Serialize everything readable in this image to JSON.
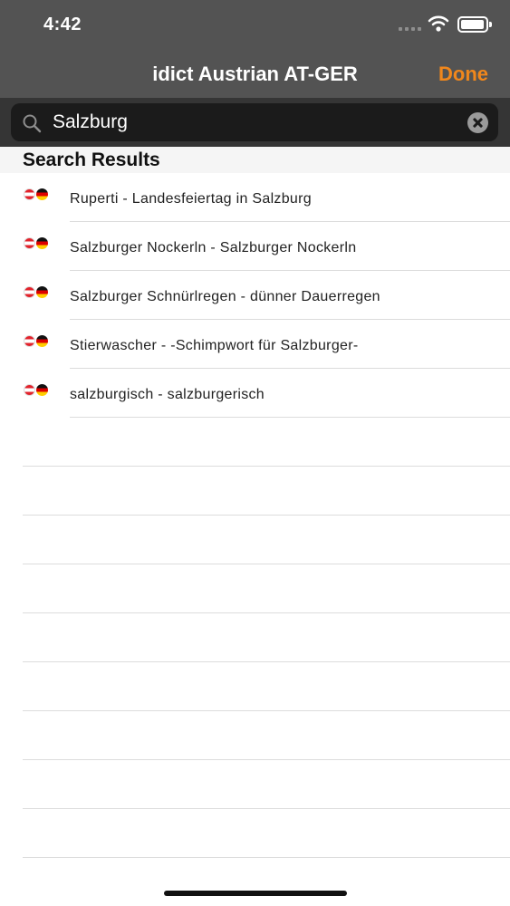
{
  "status_bar": {
    "time": "4:42"
  },
  "nav": {
    "title": "idict Austrian AT-GER",
    "done_label": "Done"
  },
  "search": {
    "value": "Salzburg"
  },
  "section": {
    "title": "Search Results"
  },
  "results": [
    {
      "text": "Ruperti - Landesfeiertag in Salzburg",
      "flags": [
        "austria-flag-icon",
        "germany-flag-icon"
      ]
    },
    {
      "text": "Salzburger Nockerln - Salzburger Nockerln",
      "flags": [
        "austria-flag-icon",
        "germany-flag-icon"
      ]
    },
    {
      "text": "Salzburger Schnürlregen - dünner Dauerregen",
      "flags": [
        "austria-flag-icon",
        "germany-flag-icon"
      ]
    },
    {
      "text": "Stierwascher - -Schimpwort für Salzburger-",
      "flags": [
        "austria-flag-icon",
        "germany-flag-icon"
      ]
    },
    {
      "text": "salzburgisch - salzburgerisch",
      "flags": [
        "austria-flag-icon",
        "germany-flag-icon"
      ]
    }
  ],
  "colors": {
    "bar_background": "#535353",
    "search_background": "#353535",
    "accent": "#f0871c"
  }
}
